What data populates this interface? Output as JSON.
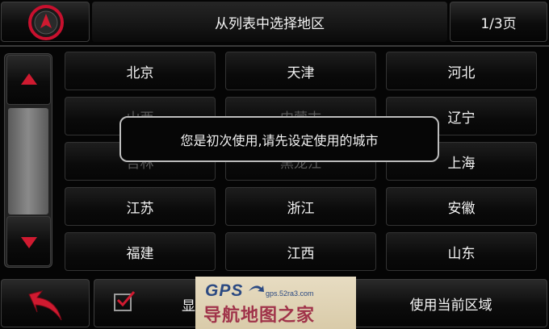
{
  "header": {
    "title": "从列表中选择地区",
    "page_indicator": "1/3页"
  },
  "regions": [
    {
      "label": "北京",
      "dim": false
    },
    {
      "label": "天津",
      "dim": false
    },
    {
      "label": "河北",
      "dim": false
    },
    {
      "label": "山西",
      "dim": true
    },
    {
      "label": "内蒙古",
      "dim": true
    },
    {
      "label": "辽宁",
      "dim": false
    },
    {
      "label": "吉林",
      "dim": true
    },
    {
      "label": "黑龙江",
      "dim": true
    },
    {
      "label": "上海",
      "dim": false
    },
    {
      "label": "江苏",
      "dim": false
    },
    {
      "label": "浙江",
      "dim": false
    },
    {
      "label": "安徽",
      "dim": false
    },
    {
      "label": "福建",
      "dim": false
    },
    {
      "label": "江西",
      "dim": false
    },
    {
      "label": "山东",
      "dim": false
    }
  ],
  "dialog": {
    "message": "您是初次使用,请先设定使用的城市"
  },
  "footer": {
    "display_label": "显",
    "use_current_label": "使用当前区域"
  },
  "watermark": {
    "brand": "GPS",
    "url": "gps.52ra3.com",
    "name": "导航地图之家"
  },
  "colors": {
    "accent_red": "#c8102e",
    "dialog_border": "#bdbdbd"
  }
}
